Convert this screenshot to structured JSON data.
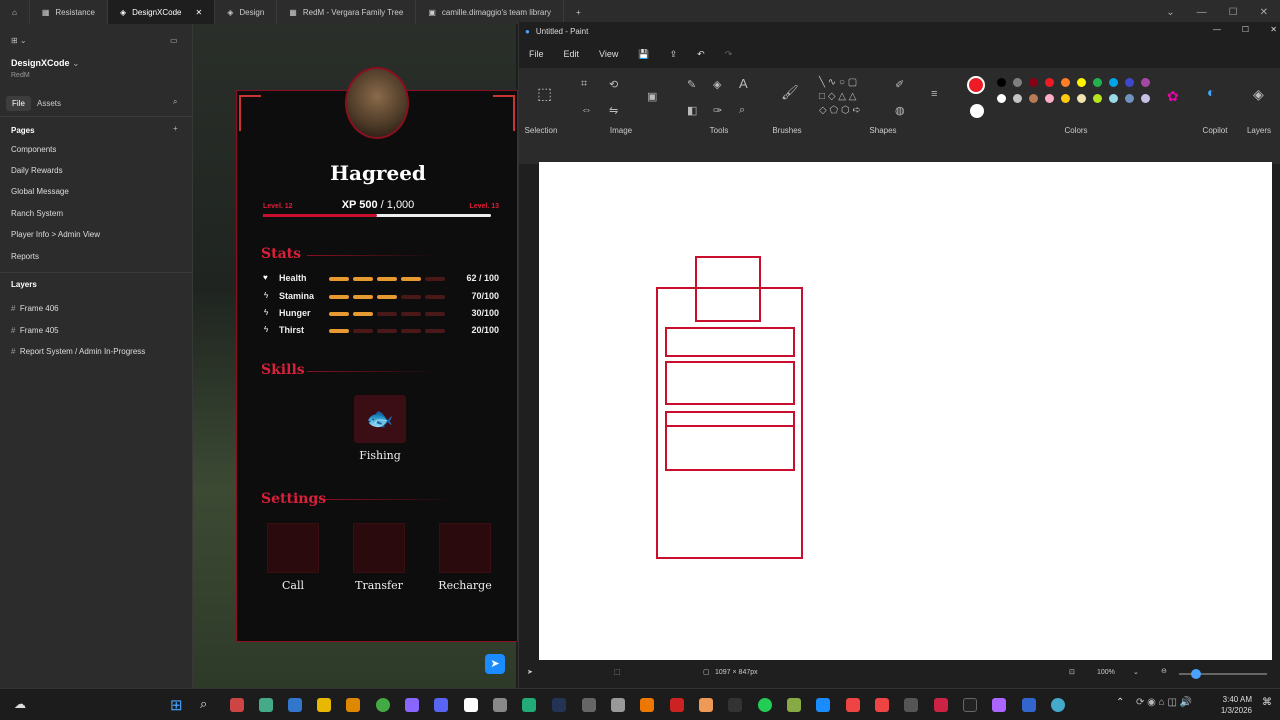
{
  "tabs": [
    {
      "label": "Resistance"
    },
    {
      "label": "DesignXCode"
    },
    {
      "label": "Design"
    },
    {
      "label": "RedM - Vergara Family Tree"
    },
    {
      "label": "camille.dimaggio's team library"
    }
  ],
  "sidebar": {
    "project_name": "DesignXCode",
    "project_sub": "RedM",
    "file_tab": "File",
    "assets_tab": "Assets",
    "pages_title": "Pages",
    "pages": [
      "Components",
      "Daily Rewards",
      "Global Message",
      "Ranch System",
      "Player Info > Admin View",
      "Reports"
    ],
    "layers_title": "Layers",
    "layers": [
      "Frame 406",
      "Frame 405",
      "Report System / Admin In-Progress"
    ]
  },
  "card": {
    "name": "Hagreed",
    "level_left": "Level. 12",
    "level_right": "Level. 13",
    "xp_label": "XP 500",
    "xp_total": "/ 1,000",
    "xp_progress": 0.5,
    "stats_title": "Stats",
    "stats": [
      {
        "label": "Health",
        "value": "62 / 100",
        "filled": 4,
        "icon": "heart-icon"
      },
      {
        "label": "Stamina",
        "value": "70/100",
        "filled": 3,
        "icon": "bolt-icon"
      },
      {
        "label": "Hunger",
        "value": "30/100",
        "filled": 2,
        "icon": "bolt-icon"
      },
      {
        "label": "Thirst",
        "value": "20/100",
        "filled": 1,
        "icon": "bolt-icon"
      }
    ],
    "skills_title": "Skills",
    "skill": "Fishing",
    "settings_title": "Settings",
    "settings": [
      "Call",
      "Transfer",
      "Recharge"
    ]
  },
  "paint": {
    "title": "Untitled - Paint",
    "menu": [
      "File",
      "Edit",
      "View"
    ],
    "groups": [
      "Selection",
      "Image",
      "Tools",
      "Brushes",
      "Shapes",
      "Colors",
      "Copilot",
      "Layers"
    ],
    "dimensions": "1097 × 847px",
    "zoom": "100%",
    "accent": "#c8102e",
    "palette": [
      "#000000",
      "#7f7f7f",
      "#880015",
      "#ed1c24",
      "#ff7f27",
      "#fff200",
      "#22b14c",
      "#00a2e8",
      "#3f48cc",
      "#a349a4",
      "#ffffff",
      "#c3c3c3",
      "#b97a57",
      "#ffaec9",
      "#ffc90e",
      "#efe4b0",
      "#b5e61d",
      "#99d9ea",
      "#7092be",
      "#c8bfe7"
    ]
  },
  "taskbar": {
    "time": "3:40 AM",
    "date": "1/3/2026"
  }
}
